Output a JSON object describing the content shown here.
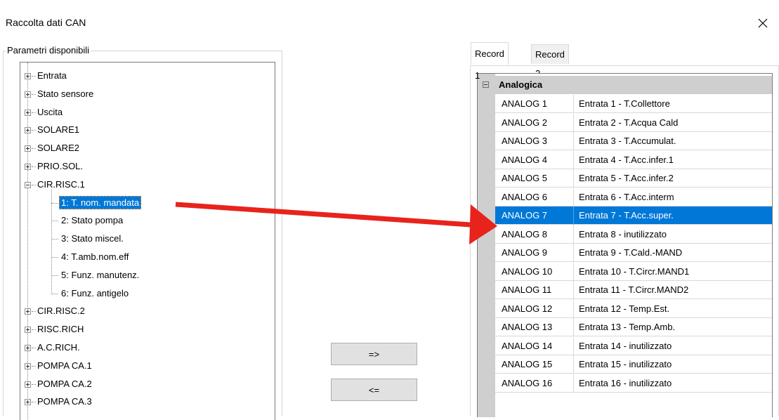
{
  "window": {
    "title": "Raccolta dati CAN"
  },
  "left_panel": {
    "group_label": "Parametri disponibili",
    "tree": [
      {
        "label": "Entrata",
        "expanded": false
      },
      {
        "label": "Stato sensore",
        "expanded": false
      },
      {
        "label": "Uscita",
        "expanded": false
      },
      {
        "label": "SOLARE1",
        "expanded": false
      },
      {
        "label": "SOLARE2",
        "expanded": false
      },
      {
        "label": "PRIO.SOL.",
        "expanded": false
      },
      {
        "label": "CIR.RISC.1",
        "expanded": true
      },
      {
        "label": "1: T. nom. mandata",
        "child": true,
        "selected": true
      },
      {
        "label": "2: Stato pompa",
        "child": true
      },
      {
        "label": "3: Stato miscel.",
        "child": true
      },
      {
        "label": "4: T.amb.nom.eff",
        "child": true
      },
      {
        "label": "5: Funz. manutenz.",
        "child": true
      },
      {
        "label": "6: Funz. antigelo",
        "child": true
      },
      {
        "label": "CIR.RISC.2",
        "expanded": false
      },
      {
        "label": "RISC.RICH",
        "expanded": false
      },
      {
        "label": "A.C.RICH.",
        "expanded": false
      },
      {
        "label": "POMPA CA.1",
        "expanded": false
      },
      {
        "label": "POMPA CA.2",
        "expanded": false
      },
      {
        "label": "POMPA CA.3",
        "expanded": false
      }
    ]
  },
  "buttons": {
    "add": "=>",
    "remove": "<="
  },
  "tabs": [
    {
      "label": "Record 1",
      "active": true
    },
    {
      "label": "Record 2",
      "active": false
    }
  ],
  "grid": {
    "category": "Analogica",
    "rows": [
      {
        "name": "ANALOG 1",
        "value": "Entrata 1 - T.Collettore"
      },
      {
        "name": "ANALOG 2",
        "value": "Entrata 2 - T.Acqua Cald"
      },
      {
        "name": "ANALOG 3",
        "value": "Entrata 3 - T.Accumulat."
      },
      {
        "name": "ANALOG 4",
        "value": "Entrata 4 - T.Acc.infer.1"
      },
      {
        "name": "ANALOG 5",
        "value": "Entrata 5 - T.Acc.infer.2"
      },
      {
        "name": "ANALOG 6",
        "value": "Entrata 6 - T.Acc.interm"
      },
      {
        "name": "ANALOG 7",
        "value": "Entrata 7 - T.Acc.super.",
        "selected": true
      },
      {
        "name": "ANALOG 8",
        "value": "Entrata 8 - inutilizzato"
      },
      {
        "name": "ANALOG 9",
        "value": "Entrata 9 - T.Cald.-MAND"
      },
      {
        "name": "ANALOG 10",
        "value": "Entrata 10 - T.Circr.MAND1"
      },
      {
        "name": "ANALOG 11",
        "value": "Entrata 11 - T.Circr.MAND2"
      },
      {
        "name": "ANALOG 12",
        "value": "Entrata 12 - Temp.Est."
      },
      {
        "name": "ANALOG 13",
        "value": "Entrata 13 - Temp.Amb."
      },
      {
        "name": "ANALOG 14",
        "value": "Entrata 14 - inutilizzato"
      },
      {
        "name": "ANALOG 15",
        "value": "Entrata 15 - inutilizzato"
      },
      {
        "name": "ANALOG 16",
        "value": "Entrata 16 - inutilizzato"
      }
    ]
  },
  "colors": {
    "selection": "#0078d7",
    "arrow": "#e8231c",
    "category_bg": "#cfcfcf"
  },
  "icons": {
    "close": "close-icon",
    "expand": "plus-box-icon",
    "collapse": "minus-box-icon"
  }
}
